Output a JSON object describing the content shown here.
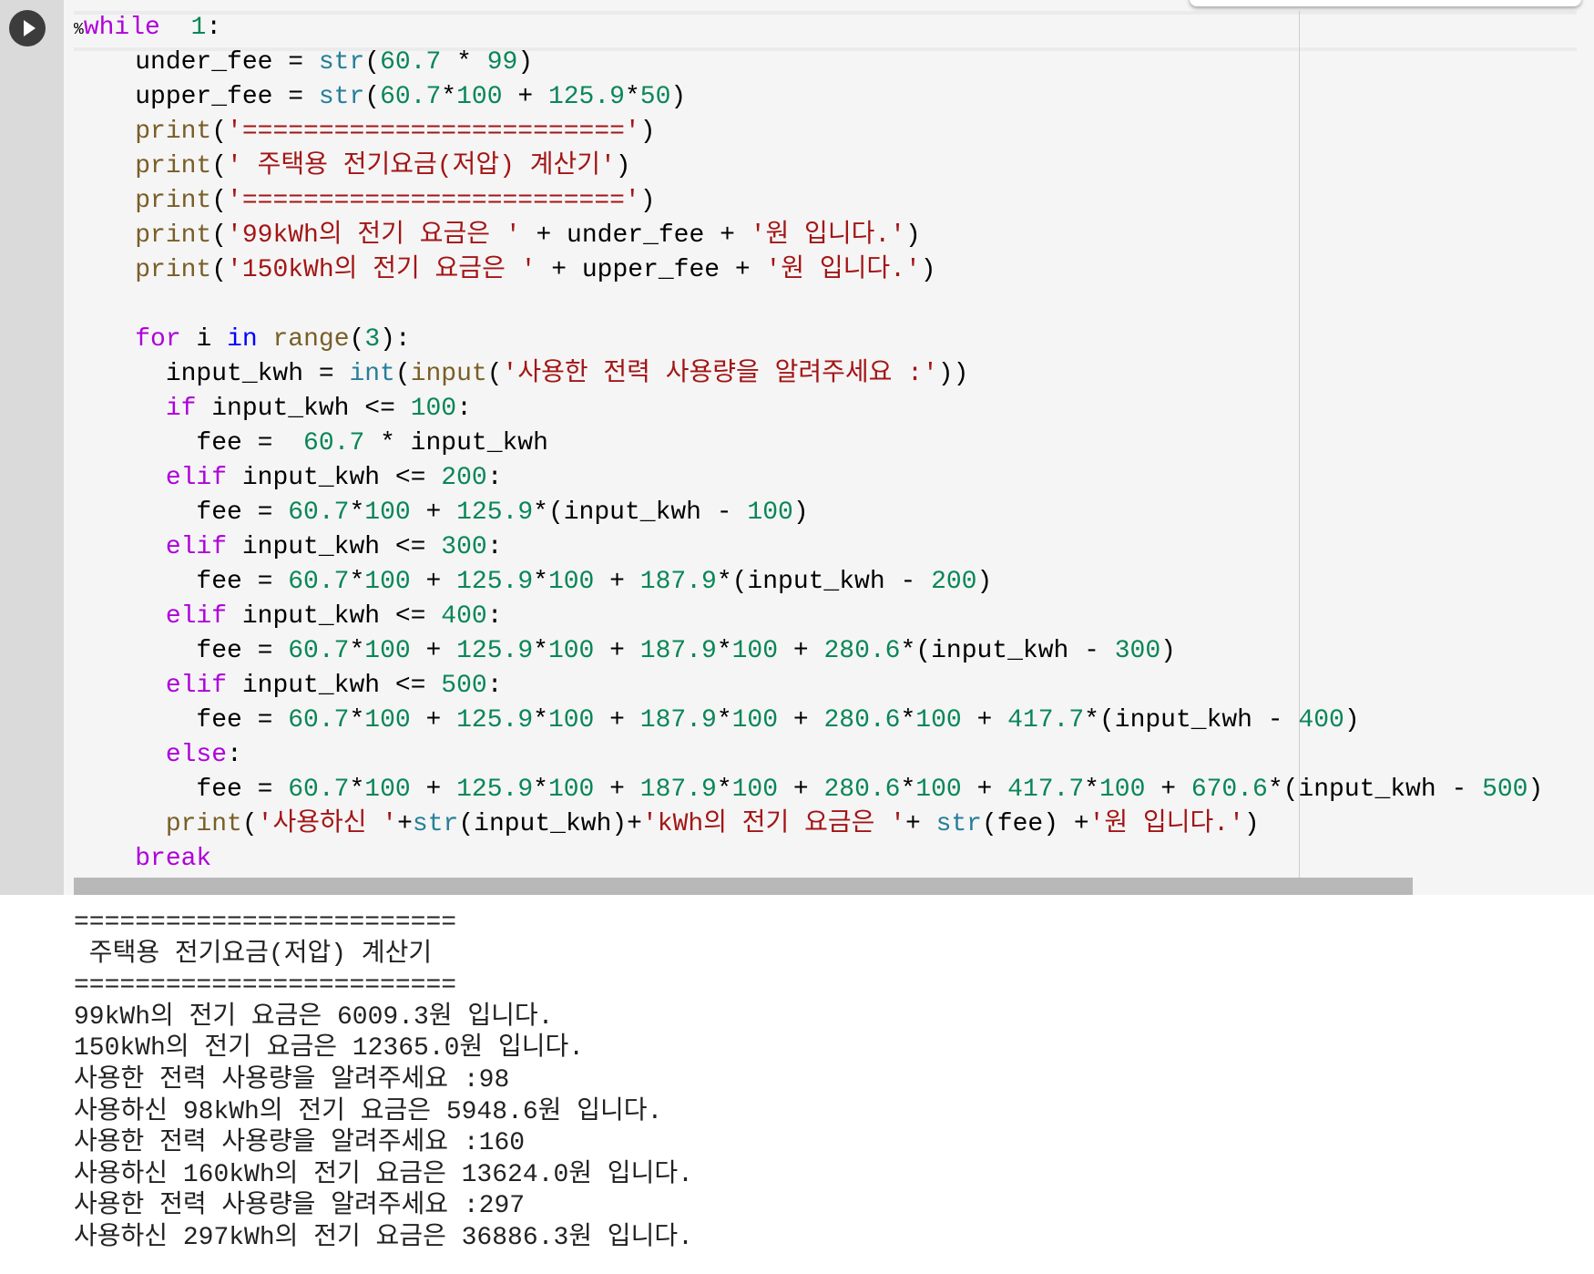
{
  "cell": {
    "run_button": "play-icon",
    "code_lines": [
      [
        [
          "mg",
          "%"
        ],
        [
          "kw",
          "while"
        ],
        [
          "",
          "  "
        ],
        [
          "num",
          "1"
        ],
        [
          "",
          ":"
        ]
      ],
      [
        [
          "",
          "    under_fee = "
        ],
        [
          "bi",
          "str"
        ],
        [
          "",
          "("
        ],
        [
          "num",
          "60.7"
        ],
        [
          "",
          " * "
        ],
        [
          "num",
          "99"
        ],
        [
          "",
          ")"
        ]
      ],
      [
        [
          "",
          "    upper_fee = "
        ],
        [
          "bi",
          "str"
        ],
        [
          "",
          "("
        ],
        [
          "num",
          "60.7"
        ],
        [
          "",
          "*"
        ],
        [
          "num",
          "100"
        ],
        [
          "",
          " + "
        ],
        [
          "num",
          "125.9"
        ],
        [
          "",
          "*"
        ],
        [
          "num",
          "50"
        ],
        [
          "",
          ")"
        ]
      ],
      [
        [
          "",
          "    "
        ],
        [
          "fn",
          "print"
        ],
        [
          "",
          "("
        ],
        [
          "str",
          "'========================='"
        ],
        [
          "",
          ")"
        ]
      ],
      [
        [
          "",
          "    "
        ],
        [
          "fn",
          "print"
        ],
        [
          "",
          "("
        ],
        [
          "str",
          "' 주택용 전기요금(저압) 계산기'"
        ],
        [
          "",
          ")"
        ]
      ],
      [
        [
          "",
          "    "
        ],
        [
          "fn",
          "print"
        ],
        [
          "",
          "("
        ],
        [
          "str",
          "'========================='"
        ],
        [
          "",
          ")"
        ]
      ],
      [
        [
          "",
          "    "
        ],
        [
          "fn",
          "print"
        ],
        [
          "",
          "("
        ],
        [
          "str",
          "'99kWh의 전기 요금은 '"
        ],
        [
          "",
          " + under_fee + "
        ],
        [
          "str",
          "'원 입니다.'"
        ],
        [
          "",
          ")"
        ]
      ],
      [
        [
          "",
          "    "
        ],
        [
          "fn",
          "print"
        ],
        [
          "",
          "("
        ],
        [
          "str",
          "'150kWh의 전기 요금은 '"
        ],
        [
          "",
          " + upper_fee + "
        ],
        [
          "str",
          "'원 입니다.'"
        ],
        [
          "",
          ")"
        ]
      ],
      [
        [
          "",
          ""
        ]
      ],
      [
        [
          "",
          "    "
        ],
        [
          "kw",
          "for"
        ],
        [
          "",
          " i "
        ],
        [
          "kb",
          "in"
        ],
        [
          "",
          " "
        ],
        [
          "fn",
          "range"
        ],
        [
          "",
          "("
        ],
        [
          "num",
          "3"
        ],
        [
          "",
          "):"
        ]
      ],
      [
        [
          "",
          "      input_kwh = "
        ],
        [
          "bi",
          "int"
        ],
        [
          "",
          "("
        ],
        [
          "fn",
          "input"
        ],
        [
          "",
          "("
        ],
        [
          "str",
          "'사용한 전력 사용량을 알려주세요 :'"
        ],
        [
          "",
          "))"
        ]
      ],
      [
        [
          "",
          "      "
        ],
        [
          "kw",
          "if"
        ],
        [
          "",
          " input_kwh <= "
        ],
        [
          "num",
          "100"
        ],
        [
          "",
          ":"
        ]
      ],
      [
        [
          "",
          "        fee =  "
        ],
        [
          "num",
          "60.7"
        ],
        [
          "",
          " * input_kwh"
        ]
      ],
      [
        [
          "",
          "      "
        ],
        [
          "kw",
          "elif"
        ],
        [
          "",
          " input_kwh <= "
        ],
        [
          "num",
          "200"
        ],
        [
          "",
          ":"
        ]
      ],
      [
        [
          "",
          "        fee = "
        ],
        [
          "num",
          "60.7"
        ],
        [
          "",
          "*"
        ],
        [
          "num",
          "100"
        ],
        [
          "",
          " + "
        ],
        [
          "num",
          "125.9"
        ],
        [
          "",
          "*(input_kwh - "
        ],
        [
          "num",
          "100"
        ],
        [
          "",
          ")"
        ]
      ],
      [
        [
          "",
          "      "
        ],
        [
          "kw",
          "elif"
        ],
        [
          "",
          " input_kwh <= "
        ],
        [
          "num",
          "300"
        ],
        [
          "",
          ":"
        ]
      ],
      [
        [
          "",
          "        fee = "
        ],
        [
          "num",
          "60.7"
        ],
        [
          "",
          "*"
        ],
        [
          "num",
          "100"
        ],
        [
          "",
          " + "
        ],
        [
          "num",
          "125.9"
        ],
        [
          "",
          "*"
        ],
        [
          "num",
          "100"
        ],
        [
          "",
          " + "
        ],
        [
          "num",
          "187.9"
        ],
        [
          "",
          "*(input_kwh - "
        ],
        [
          "num",
          "200"
        ],
        [
          "",
          ")"
        ]
      ],
      [
        [
          "",
          "      "
        ],
        [
          "kw",
          "elif"
        ],
        [
          "",
          " input_kwh <= "
        ],
        [
          "num",
          "400"
        ],
        [
          "",
          ":"
        ]
      ],
      [
        [
          "",
          "        fee = "
        ],
        [
          "num",
          "60.7"
        ],
        [
          "",
          "*"
        ],
        [
          "num",
          "100"
        ],
        [
          "",
          " + "
        ],
        [
          "num",
          "125.9"
        ],
        [
          "",
          "*"
        ],
        [
          "num",
          "100"
        ],
        [
          "",
          " + "
        ],
        [
          "num",
          "187.9"
        ],
        [
          "",
          "*"
        ],
        [
          "num",
          "100"
        ],
        [
          "",
          " + "
        ],
        [
          "num",
          "280.6"
        ],
        [
          "",
          "*(input_kwh - "
        ],
        [
          "num",
          "300"
        ],
        [
          "",
          ")"
        ]
      ],
      [
        [
          "",
          "      "
        ],
        [
          "kw",
          "elif"
        ],
        [
          "",
          " input_kwh <= "
        ],
        [
          "num",
          "500"
        ],
        [
          "",
          ":"
        ]
      ],
      [
        [
          "",
          "        fee = "
        ],
        [
          "num",
          "60.7"
        ],
        [
          "",
          "*"
        ],
        [
          "num",
          "100"
        ],
        [
          "",
          " + "
        ],
        [
          "num",
          "125.9"
        ],
        [
          "",
          "*"
        ],
        [
          "num",
          "100"
        ],
        [
          "",
          " + "
        ],
        [
          "num",
          "187.9"
        ],
        [
          "",
          "*"
        ],
        [
          "num",
          "100"
        ],
        [
          "",
          " + "
        ],
        [
          "num",
          "280.6"
        ],
        [
          "",
          "*"
        ],
        [
          "num",
          "100"
        ],
        [
          "",
          " + "
        ],
        [
          "num",
          "417.7"
        ],
        [
          "",
          "*(input_kwh - "
        ],
        [
          "num",
          "400"
        ],
        [
          "",
          ")"
        ]
      ],
      [
        [
          "",
          "      "
        ],
        [
          "kw",
          "else"
        ],
        [
          "",
          ":"
        ]
      ],
      [
        [
          "",
          "        fee = "
        ],
        [
          "num",
          "60.7"
        ],
        [
          "",
          "*"
        ],
        [
          "num",
          "100"
        ],
        [
          "",
          " + "
        ],
        [
          "num",
          "125.9"
        ],
        [
          "",
          "*"
        ],
        [
          "num",
          "100"
        ],
        [
          "",
          " + "
        ],
        [
          "num",
          "187.9"
        ],
        [
          "",
          "*"
        ],
        [
          "num",
          "100"
        ],
        [
          "",
          " + "
        ],
        [
          "num",
          "280.6"
        ],
        [
          "",
          "*"
        ],
        [
          "num",
          "100"
        ],
        [
          "",
          " + "
        ],
        [
          "num",
          "417.7"
        ],
        [
          "",
          "*"
        ],
        [
          "num",
          "100"
        ],
        [
          "",
          " + "
        ],
        [
          "num",
          "670.6"
        ],
        [
          "",
          "*(input_kwh - "
        ],
        [
          "num",
          "500"
        ],
        [
          "",
          ")"
        ]
      ],
      [
        [
          "",
          "      "
        ],
        [
          "fn",
          "print"
        ],
        [
          "",
          "("
        ],
        [
          "str",
          "'사용하신 '"
        ],
        [
          "",
          "+"
        ],
        [
          "bi",
          "str"
        ],
        [
          "",
          "(input_kwh)+"
        ],
        [
          "str",
          "'kWh의 전기 요금은 '"
        ],
        [
          "",
          "+ "
        ],
        [
          "bi",
          "str"
        ],
        [
          "",
          "(fee) +"
        ],
        [
          "str",
          "'원 입니다.'"
        ],
        [
          "",
          ")"
        ]
      ],
      [
        [
          "",
          "    "
        ],
        [
          "kw",
          "break"
        ]
      ]
    ]
  },
  "output": {
    "lines": [
      "=========================",
      " 주택용 전기요금(저압) 계산기",
      "=========================",
      "99kWh의 전기 요금은 6009.3원 입니다.",
      "150kWh의 전기 요금은 12365.0원 입니다.",
      "사용한 전력 사용량을 알려주세요 :98",
      "사용하신 98kWh의 전기 요금은 5948.6원 입니다.",
      "사용한 전력 사용량을 알려주세요 :160",
      "사용하신 160kWh의 전기 요금은 13624.0원 입니다.",
      "사용한 전력 사용량을 알려주세요 :297",
      "사용하신 297kWh의 전기 요금은 36886.3원 입니다."
    ]
  }
}
